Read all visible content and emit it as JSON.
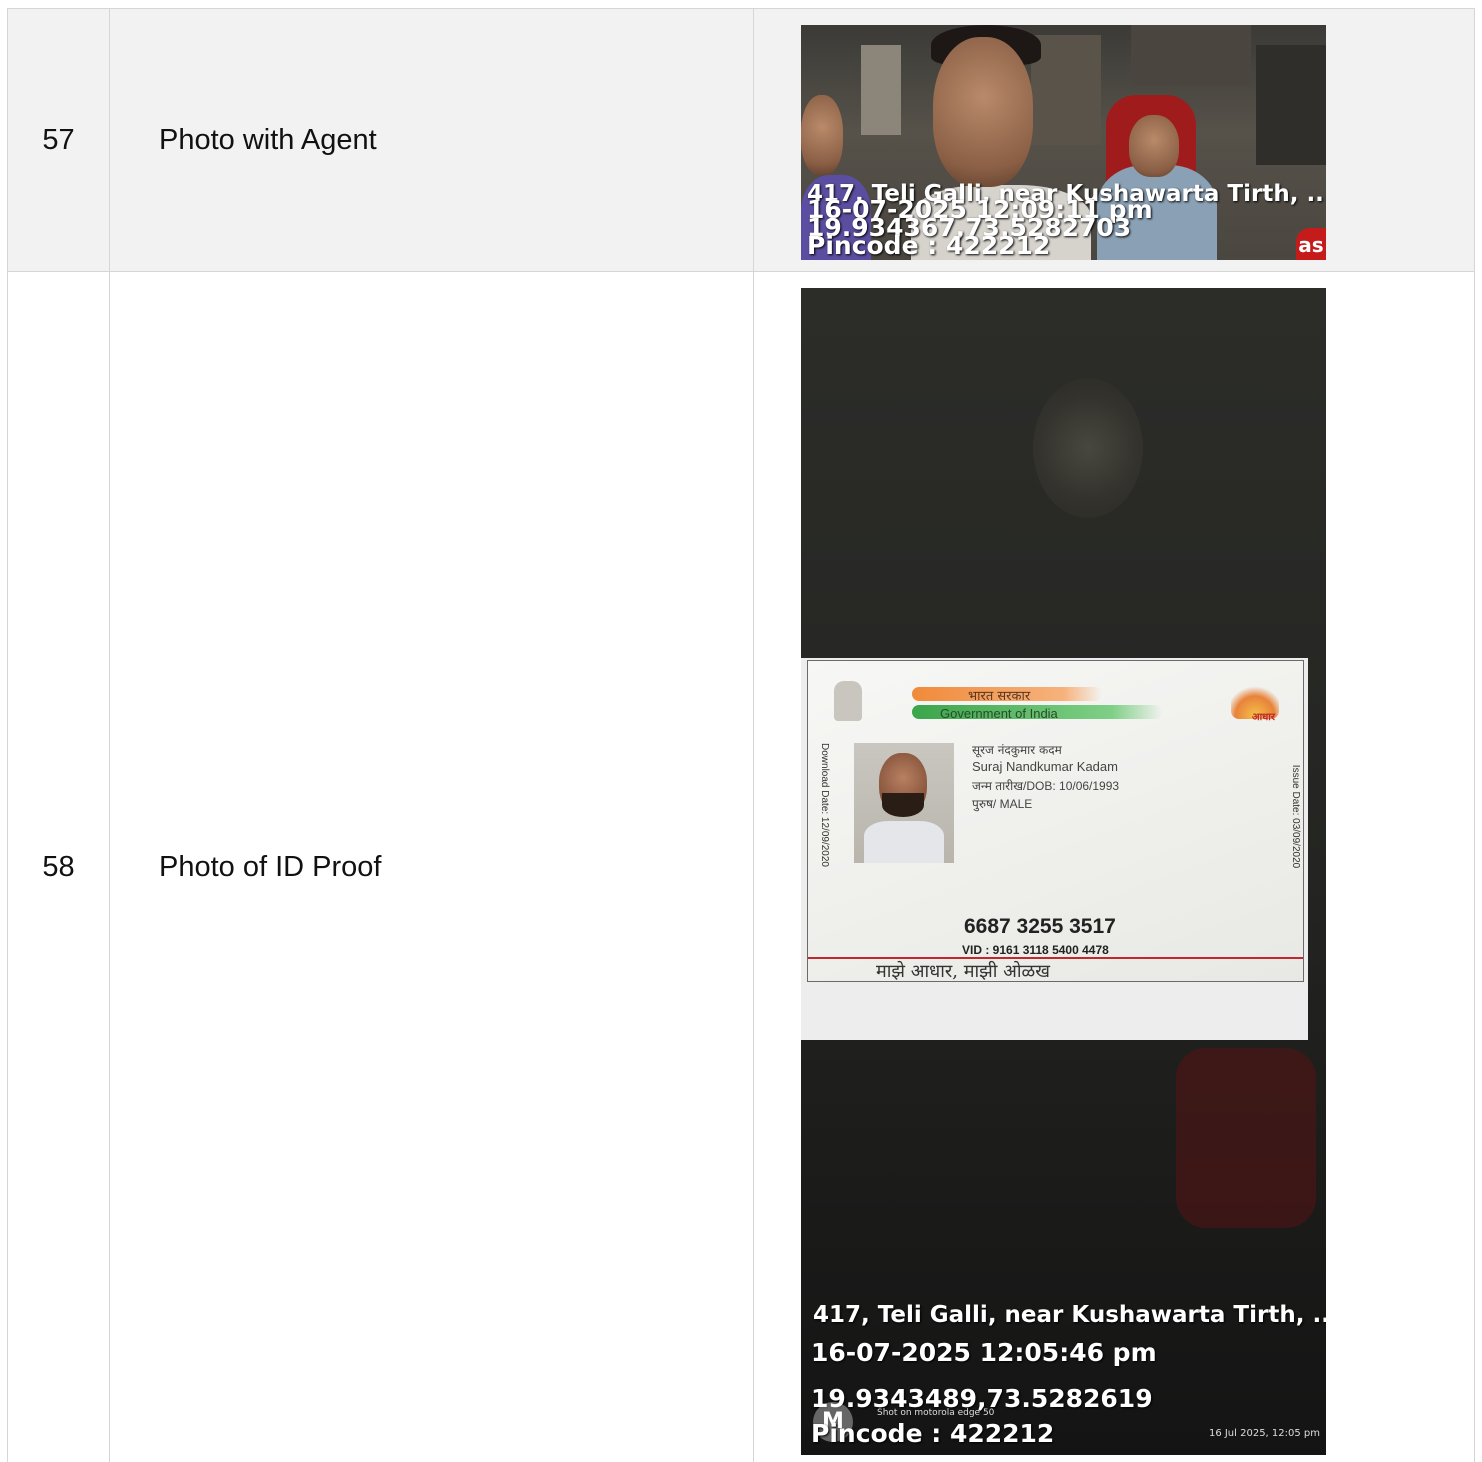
{
  "rows": [
    {
      "number": "57",
      "label": "Photo with Agent",
      "photo": {
        "overlay": {
          "address": "417, Teli Galli, near Kushawarta Tirth, ...",
          "datetime": "16-07-2025 12:09:11 pm",
          "coordinates": "19.934367,73.5282703",
          "pincode": "Pincode : 422212"
        },
        "badge": "as"
      }
    },
    {
      "number": "58",
      "label": "Photo of ID Proof",
      "photo": {
        "card": {
          "gov_hindi": "भारत सरकार",
          "gov_english": "Government of India",
          "logo_word": "आधार",
          "download_date": "Download Date: 12/09/2020",
          "issue_date": "Issue Date: 03/09/2020",
          "name_local": "सूरज नंदकुमार कदम",
          "name": "Suraj Nandkumar Kadam",
          "dob": "जन्म तारीख/DOB: 10/06/1993",
          "gender": "पुरुष/ MALE",
          "number": "6687 3255 3517",
          "vid": "VID : 9161 3118 5400 4478",
          "slogan": "माझे आधार, माझी ओळख"
        },
        "overlay": {
          "address": "417, Teli Galli, near Kushawarta Tirth, ...",
          "datetime": "16-07-2025 12:05:46 pm",
          "coordinates": "19.9343489,73.5282619",
          "pincode": "Pincode : 422212"
        },
        "shot_on": "Shot on motorola edge 50",
        "date_stamp": "16 Jul 2025, 12:05 pm"
      }
    }
  ],
  "colors": {
    "row_shade": "#f2f2f2",
    "border": "#d6d6d6",
    "aadhaar_red": "#c2272d"
  }
}
